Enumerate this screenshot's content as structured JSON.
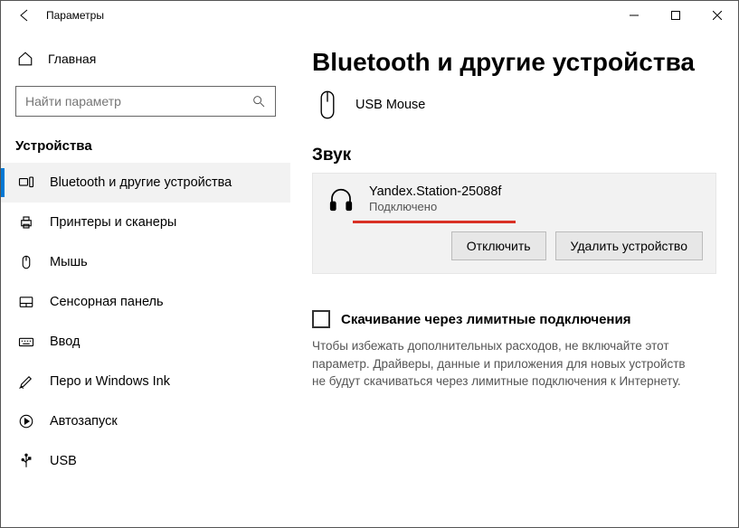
{
  "window": {
    "title": "Параметры"
  },
  "sidebar": {
    "home": "Главная",
    "search_placeholder": "Найти параметр",
    "section": "Устройства",
    "items": [
      {
        "label": "Bluetooth и другие устройства",
        "selected": true
      },
      {
        "label": "Принтеры и сканеры"
      },
      {
        "label": "Мышь"
      },
      {
        "label": "Сенсорная панель"
      },
      {
        "label": "Ввод"
      },
      {
        "label": "Перо и Windows Ink"
      },
      {
        "label": "Автозапуск"
      },
      {
        "label": "USB"
      }
    ]
  },
  "main": {
    "heading": "Bluetooth и другие устройства",
    "device_other": {
      "name": "USB Mouse"
    },
    "sound_heading": "Звук",
    "sound_device": {
      "name": "Yandex.Station-25088f",
      "status": "Подключено",
      "disconnect": "Отключить",
      "remove": "Удалить устройство"
    },
    "download_checkbox": "Скачивание через лимитные подключения",
    "download_desc": "Чтобы избежать дополнительных расходов, не включайте этот параметр. Драйверы, данные и приложения для новых устройств не будут скачиваться через лимитные подключения к Интернету."
  }
}
